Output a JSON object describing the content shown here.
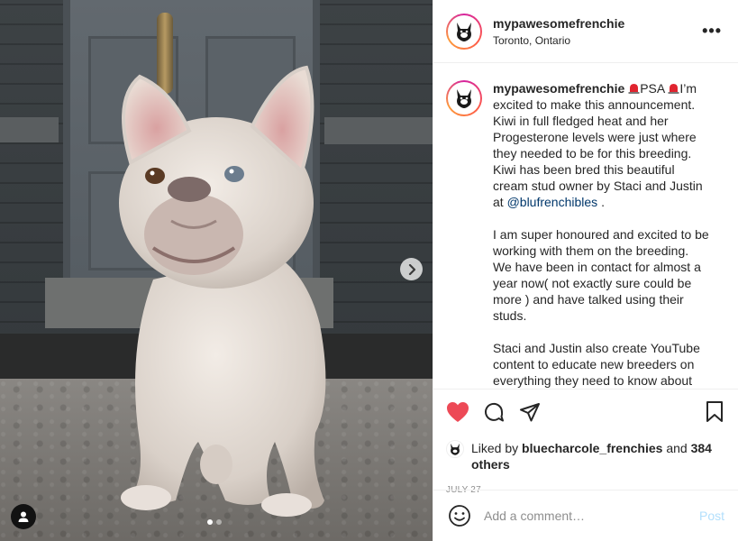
{
  "post": {
    "username": "mypawesomefrenchie",
    "location": "Toronto, Ontario",
    "more_icon": "more-horizontal-icon",
    "caption": {
      "p1_a": "PSA",
      "p1_b": "I’m excited to make this announcement. Kiwi in full fledged heat and her Progesterone levels were just where they needed to be for this breeding. Kiwi has been bred this beautiful cream stud owner by Staci and Justin at",
      "mention": "@blufrenchibles",
      "p1_end": ".",
      "p2": "I am super honoured and excited to be working with them on the breeding. We have been in contact for almost a year now( not exactly sure could be more ) and have talked using their studs.",
      "p3": "Staci and Justin also create YouTube content to educate new breeders on everything they need to know about"
    },
    "carousel": {
      "total": 2,
      "active": 1
    }
  },
  "likes": {
    "prefix": "Liked by",
    "user": "bluecharcole_frenchies",
    "and": "and",
    "others": "384 others"
  },
  "date": "JULY 27",
  "comment": {
    "placeholder": "Add a comment…",
    "post_label": "Post"
  },
  "colors": {
    "heart": "#ed4956",
    "mention": "#00376b",
    "post_disabled": "#b2dffc",
    "muted": "#8e8e8e"
  }
}
